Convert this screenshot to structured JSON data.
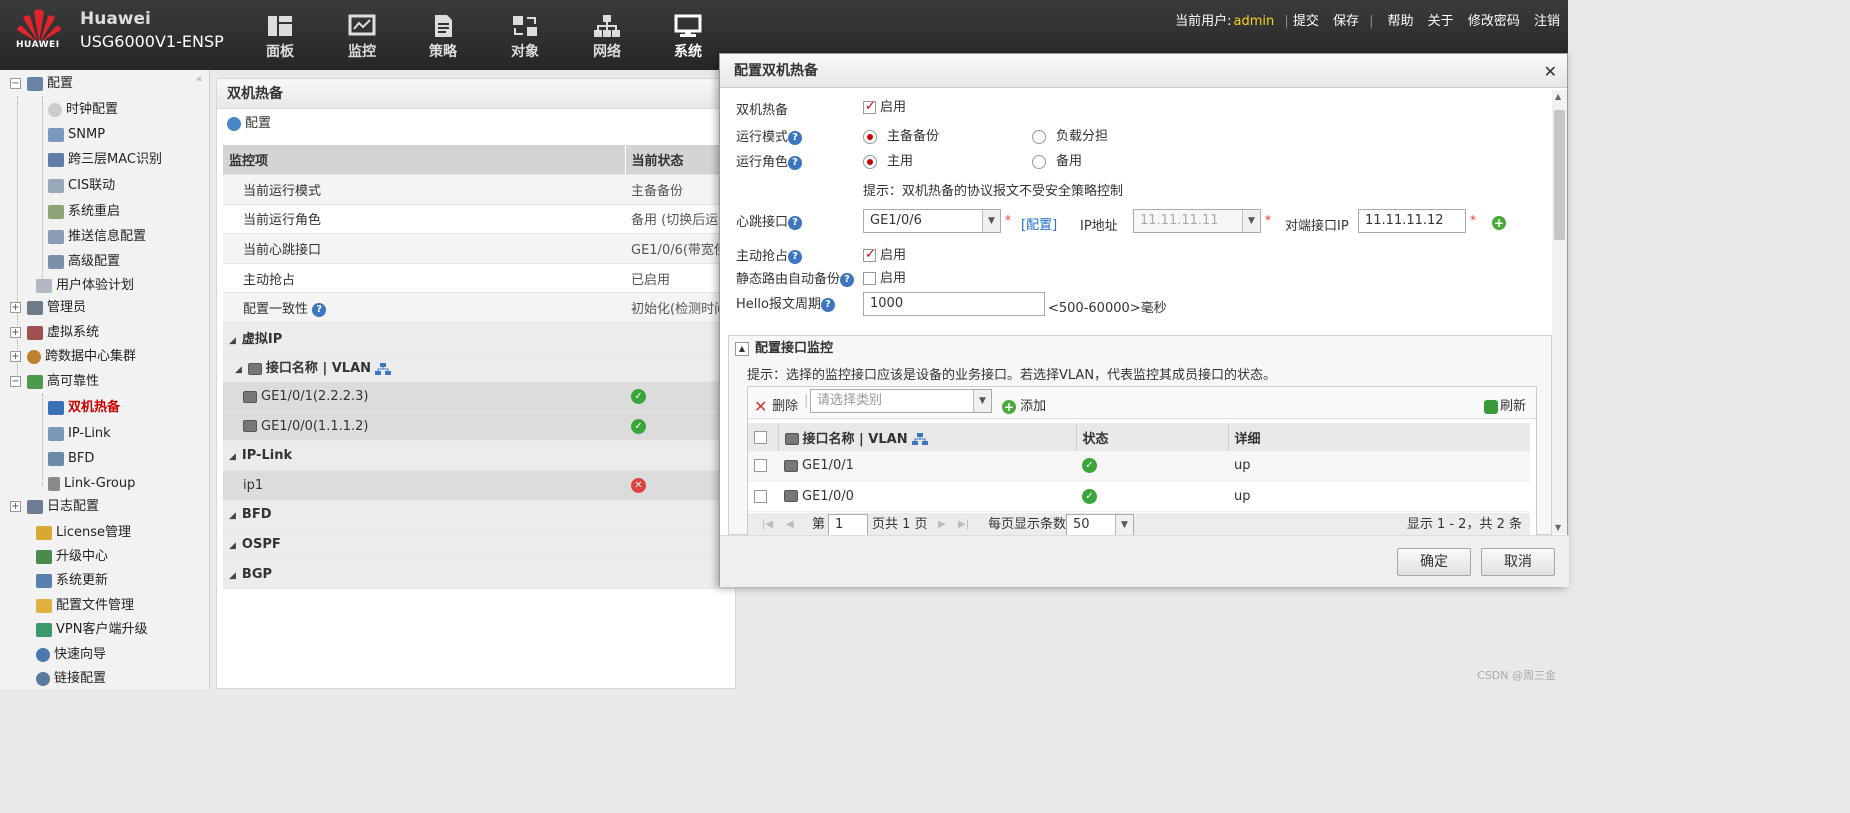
{
  "header": {
    "brand": "Huawei",
    "logo_text": "HUAWEI",
    "model": "USG6000V1-ENSP",
    "nav": [
      {
        "label": "面板",
        "icon": "dashboard-icon"
      },
      {
        "label": "监控",
        "icon": "monitor-icon"
      },
      {
        "label": "策略",
        "icon": "policy-icon"
      },
      {
        "label": "对象",
        "icon": "object-icon"
      },
      {
        "label": "网络",
        "icon": "network-icon"
      },
      {
        "label": "系统",
        "icon": "system-icon"
      }
    ],
    "current_user_label": "当前用户:",
    "username": "admin",
    "links": [
      "提交",
      "保存",
      "帮助",
      "关于",
      "修改密码",
      "注销"
    ]
  },
  "sidebar": {
    "items": [
      {
        "label": "配置"
      },
      {
        "label": "时钟配置"
      },
      {
        "label": "SNMP"
      },
      {
        "label": "跨三层MAC识别"
      },
      {
        "label": "CIS联动"
      },
      {
        "label": "系统重启"
      },
      {
        "label": "推送信息配置"
      },
      {
        "label": "高级配置"
      },
      {
        "label": "用户体验计划"
      },
      {
        "label": "管理员"
      },
      {
        "label": "虚拟系统"
      },
      {
        "label": "跨数据中心集群"
      },
      {
        "label": "高可靠性"
      },
      {
        "label": "双机热备"
      },
      {
        "label": "IP-Link"
      },
      {
        "label": "BFD"
      },
      {
        "label": "Link-Group"
      },
      {
        "label": "日志配置"
      },
      {
        "label": "License管理"
      },
      {
        "label": "升级中心"
      },
      {
        "label": "系统更新"
      },
      {
        "label": "配置文件管理"
      },
      {
        "label": "VPN客户端升级"
      },
      {
        "label": "快速向导"
      },
      {
        "label": "链接配置"
      }
    ]
  },
  "main": {
    "title": "双机热备",
    "config_label": "配置",
    "columns": [
      "监控项",
      "当前状态"
    ],
    "rows": [
      {
        "item": "当前运行模式",
        "status": "主备备份"
      },
      {
        "item": "当前运行角色",
        "status": "备用 (切换后运行"
      },
      {
        "item": "当前心跳接口",
        "status": "GE1/0/6(带宽使"
      },
      {
        "item": "主动抢占",
        "status": "已启用"
      },
      {
        "item": "配置一致性",
        "status": "初始化(检测时间"
      }
    ],
    "groups": {
      "virtual_ip": "虚拟IP",
      "iface_header": "接口名称 | VLAN",
      "ifaces": [
        "GE1/0/1(2.2.2.3)",
        "GE1/0/0(1.1.1.2)"
      ],
      "iplink": "IP-Link",
      "iplink_items": [
        "ip1"
      ],
      "bfd": "BFD",
      "ospf": "OSPF",
      "bgp": "BGP"
    }
  },
  "dialog": {
    "title": "配置双机热备",
    "hot_standby_label": "双机热备",
    "enable_text": "启用",
    "run_mode_label": "运行模式",
    "run_mode_options": [
      "主备备份",
      "负载分担"
    ],
    "run_role_label": "运行角色",
    "run_role_options": [
      "主用",
      "备用"
    ],
    "tip": "提示：双机热备的协议报文不受安全策略控制",
    "heartbeat_label": "心跳接口",
    "heartbeat_value": "GE1/0/6",
    "config_link": "[配置]",
    "ip_label": "IP地址",
    "ip_value": "11.11.11.11",
    "peer_ip_label": "对端接口IP",
    "peer_ip_value": "11.11.11.12",
    "preempt_label": "主动抢占",
    "static_route_label": "静态路由自动备份",
    "hello_label": "Hello报文周期",
    "hello_value": "1000",
    "hello_hint": "<500-60000>毫秒",
    "monitor": {
      "title": "配置接口监控",
      "tip": "提示：选择的监控接口应该是设备的业务接口。若选择VLAN，代表监控其成员接口的状态。",
      "delete_label": "删除",
      "type_placeholder": "请选择类别",
      "add_label": "添加",
      "refresh_label": "刷新",
      "columns": [
        "接口名称 | VLAN",
        "状态",
        "详细"
      ],
      "rows": [
        {
          "name": "GE1/0/1",
          "detail": "up"
        },
        {
          "name": "GE1/0/0",
          "detail": "up"
        }
      ],
      "pager": {
        "page_prefix": "第",
        "page_value": "1",
        "page_suffix": "页共 1 页",
        "per_page_label": "每页显示条数",
        "per_page_value": "50",
        "summary": "显示 1 - 2，共 2 条"
      }
    },
    "ok_label": "确定",
    "cancel_label": "取消"
  },
  "watermark": "CSDN @周三金"
}
